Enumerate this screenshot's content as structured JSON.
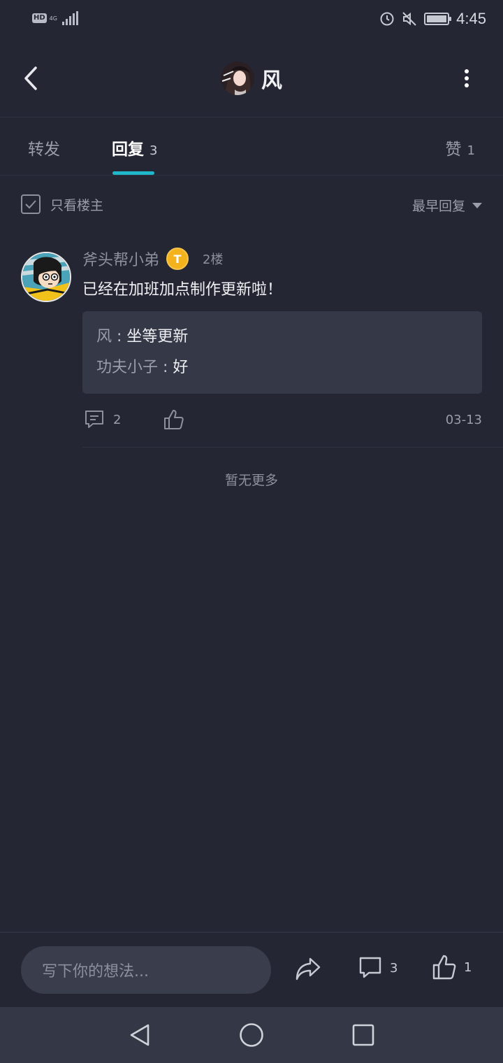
{
  "status_bar": {
    "hd": "HD",
    "network": "4G",
    "time": "4:45"
  },
  "header": {
    "title": "风"
  },
  "tabs": [
    {
      "label": "转发"
    },
    {
      "label": "回复",
      "count": "3"
    },
    {
      "label": "赞",
      "count": "1"
    }
  ],
  "filter": {
    "only_op_label": "只看楼主",
    "sort_label": "最早回复"
  },
  "comment": {
    "username": "斧头帮小弟",
    "badge_letter": "T",
    "floor": "2楼",
    "text": "已经在加班加点制作更新啦！",
    "sub_replies": [
      {
        "user": "风",
        "sep": " : ",
        "text": "坐等更新"
      },
      {
        "user": "功夫小子",
        "sep": " : ",
        "text": "好"
      }
    ],
    "reply_count": "2",
    "date": "03-13"
  },
  "no_more_text": "暂无更多",
  "bottom_bar": {
    "input_placeholder": "写下你的想法...",
    "comment_count": "3",
    "like_count": "1"
  },
  "colors": {
    "background": "#242633",
    "accent": "#1fb7c9",
    "badge": "#f4b21c"
  }
}
